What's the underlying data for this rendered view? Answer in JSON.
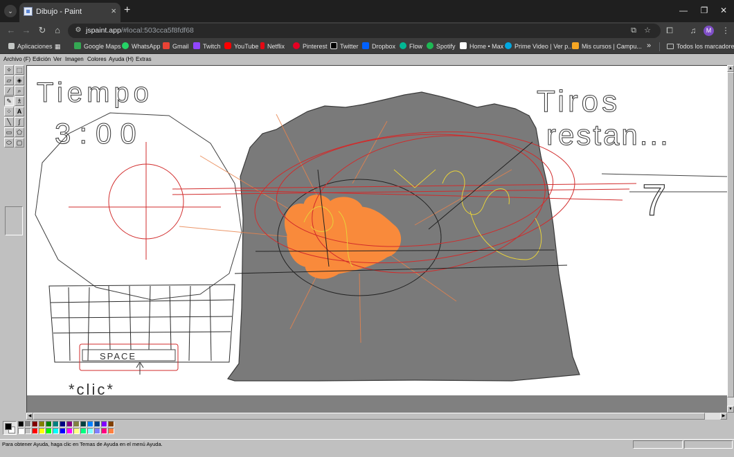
{
  "browser": {
    "tab_title": "Dibujo - Paint",
    "url_host": "jspaint.app",
    "url_rest": "/#local:503cca5f8fdf68",
    "avatar_letter": "M",
    "bookmarks": [
      {
        "label": "Aplicaciones",
        "color": "#c4c7c5"
      },
      {
        "label": "Google Maps",
        "color": "#34a853"
      },
      {
        "label": "WhatsApp",
        "color": "#25d366"
      },
      {
        "label": "Gmail",
        "color": "#ea4335"
      },
      {
        "label": "Twitch",
        "color": "#9146ff"
      },
      {
        "label": "YouTube",
        "color": "#ff0000"
      },
      {
        "label": "Netflix",
        "color": "#e50914"
      },
      {
        "label": "Pinterest",
        "color": "#e60023"
      },
      {
        "label": "Twitter",
        "color": "#ffffff"
      },
      {
        "label": "Dropbox",
        "color": "#0061ff"
      },
      {
        "label": "Flow",
        "color": "#00b894"
      },
      {
        "label": "Spotify",
        "color": "#1db954"
      },
      {
        "label": "Home • Max",
        "color": "#ffffff"
      },
      {
        "label": "Prime Video | Ver p...",
        "color": "#00a8e1"
      },
      {
        "label": "Mis cursos | Campu...",
        "color": "#f5a623"
      }
    ],
    "all_bookmarks": "Todos los marcadores"
  },
  "paint": {
    "menus": [
      "Archivo (F)",
      "Edición",
      "Ver",
      "Imagen",
      "Colores",
      "Ayuda (H)",
      "Extras"
    ],
    "tools": [
      "free-form-select",
      "select",
      "eraser",
      "fill",
      "pick-color",
      "magnifier",
      "pencil",
      "brush",
      "airbrush",
      "text",
      "line",
      "curve",
      "rectangle",
      "polygon",
      "ellipse",
      "rounded-rectangle"
    ],
    "foreground_color": "#000000",
    "background_color": "#ffffff",
    "palette": [
      "#000000",
      "#808080",
      "#800000",
      "#808000",
      "#008000",
      "#008080",
      "#000080",
      "#800080",
      "#808040",
      "#004040",
      "#0080ff",
      "#004080",
      "#8000ff",
      "#804000",
      "#ffffff",
      "#c0c0c0",
      "#ff0000",
      "#ffff00",
      "#00ff00",
      "#00ffff",
      "#0000ff",
      "#ff00ff",
      "#ffff80",
      "#00ff80",
      "#80ffff",
      "#8080ff",
      "#ff0080",
      "#ff8040"
    ],
    "status_text": "Para obtener Ayuda, haga clic en Temas de Ayuda en el menú Ayuda.",
    "drawing_texts": {
      "tiempo": "Tiempo",
      "tiempo_value": "3:00",
      "tiros": "Tiros",
      "restantes": "restan...",
      "tiros_value": "7",
      "space": "SPACE",
      "click": "*clic*"
    }
  }
}
